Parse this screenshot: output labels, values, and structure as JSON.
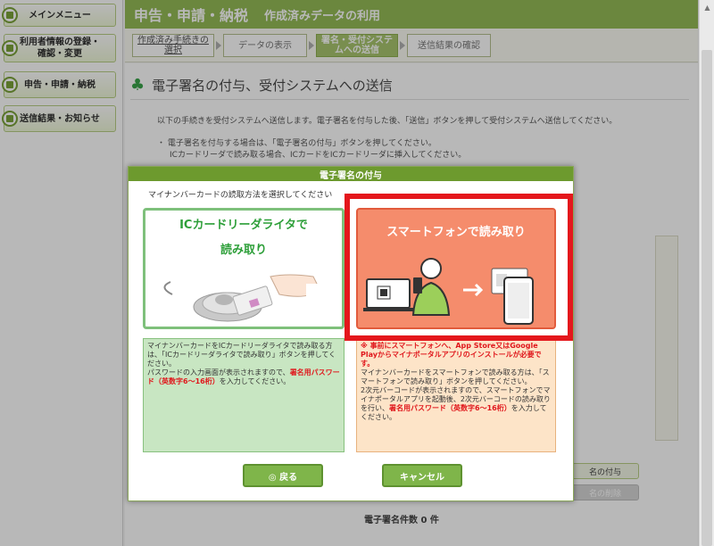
{
  "sidebar": {
    "items": [
      {
        "label": "メインメニュー"
      },
      {
        "label": "利用者情報の登録・\n確認・変更"
      },
      {
        "label": "申告・申請・納税"
      },
      {
        "label": "送信結果・お知らせ"
      }
    ]
  },
  "header": {
    "title": "申告・申請・納税",
    "subtitle": "作成済みデータの利用"
  },
  "steps": [
    {
      "label": "作成済み手続きの\n選択"
    },
    {
      "label": "データの表示"
    },
    {
      "label": "署名・受付システ\nムへの送信"
    },
    {
      "label": "送信結果の確認"
    }
  ],
  "page": {
    "title": "電子署名の付与、受付システムへの送信",
    "intro": "以下の手続きを受付システムへ送信します。電子署名を付与した後、「送信」ボタンを押して受付システムへ送信してください。",
    "bullet_line1": "・ 電子署名を付与する場合は、「電子署名の付与」ボタンを押してください。",
    "bullet_line2": "ICカードリーダで読み取る場合、ICカードをICカードリーダに挿入してください。",
    "signature_count": "電子署名件数 0 件",
    "btn_add_signature": "名の付与",
    "btn_delete_signature": "名の削除"
  },
  "modal": {
    "title": "電子署名の付与",
    "prompt": "マイナンバーカードの読取方法を選択してください",
    "ic_option": {
      "line1": "ICカードリーダライタで",
      "line2": "読み取り"
    },
    "smartphone_option": {
      "label": "スマートフォンで読み取り"
    },
    "ic_desc": {
      "part1": "マイナンバーカードをICカードリーダライタで読み取る方は、「ICカードリーダライタで読み取り」ボタンを押してください。\nパスワードの入力画面が表示されますので、",
      "red": "署名用パスワード（英数字6～16桁）",
      "part2": "を入力してください。"
    },
    "sp_desc": {
      "notice": "※ 事前にスマートフォンへ、App Store又はGoogle Playからマイナポータルアプリのインストールが必要です。",
      "part1": "マイナンバーカードをスマートフォンで読み取る方は、「スマートフォンで読み取り」ボタンを押してください。\n2次元バーコードが表示されますので、スマートフォンでマイナポータルアプリを起動後、2次元バーコードの読み取りを行い、",
      "red": "署名用パスワード（英数字6～16桁）",
      "part2": "を入力してください。"
    },
    "back_label": "◎ 戻る",
    "cancel_label": "キャンセル"
  },
  "colors": {
    "header": "#95bb57",
    "highlight": "#e4171c",
    "smartphone": "#f58c6c",
    "ic_green": "#2d9f39"
  }
}
